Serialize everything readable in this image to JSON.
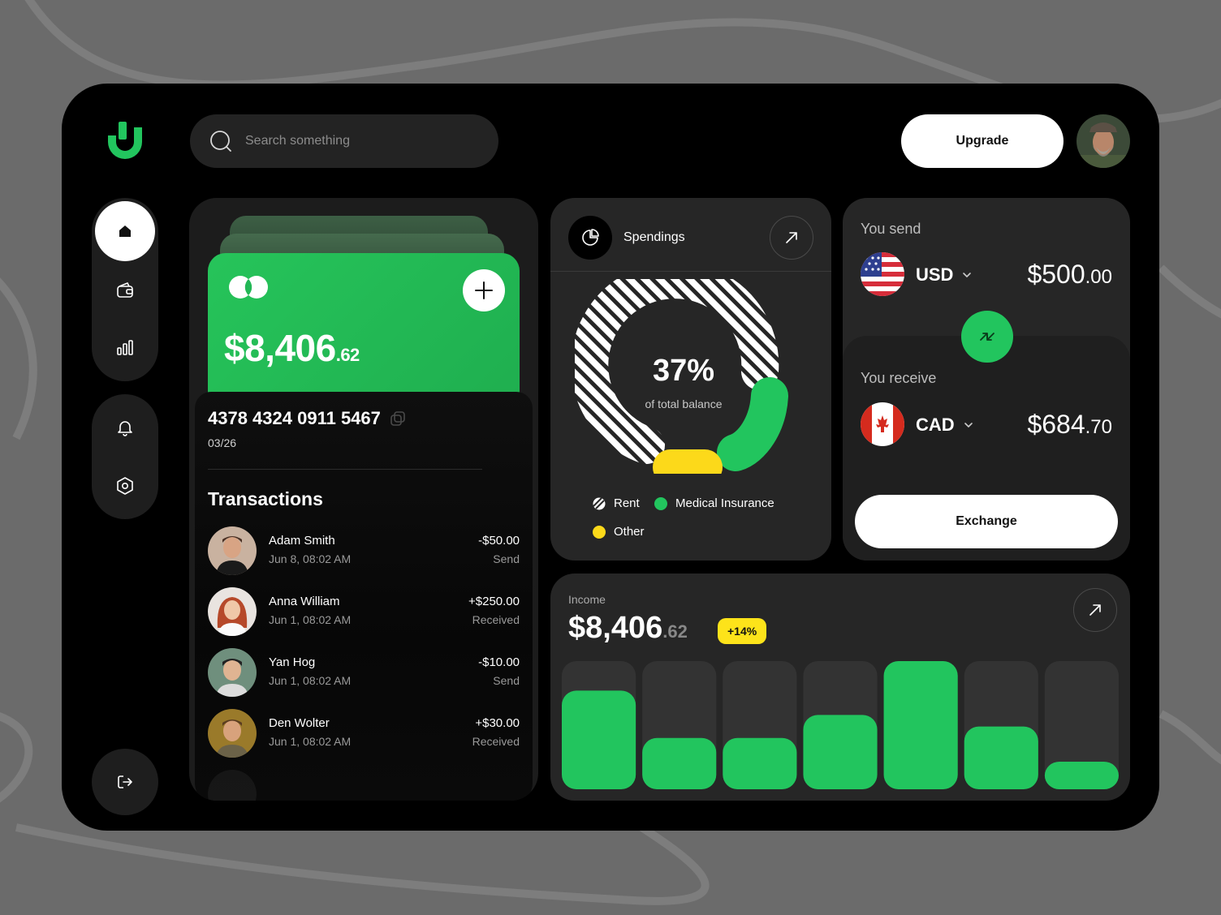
{
  "search": {
    "placeholder": "Search something"
  },
  "header": {
    "upgrade_label": "Upgrade"
  },
  "card": {
    "balance_main": "$8,406",
    "balance_cents": ".62",
    "number": "4378 4324 0911 5467",
    "expiry": "03/26"
  },
  "transactions": {
    "title": "Transactions",
    "items": [
      {
        "name": "Adam Smith",
        "date": "Jun 8, 08:02 AM",
        "amount": "-$50.00",
        "status": "Send"
      },
      {
        "name": "Anna William",
        "date": "Jun 1, 08:02 AM",
        "amount": "+$250.00",
        "status": "Received"
      },
      {
        "name": "Yan Hog",
        "date": "Jun 1, 08:02 AM",
        "amount": "-$10.00",
        "status": "Send"
      },
      {
        "name": "Den Wolter",
        "date": "Jun 1, 08:02 AM",
        "amount": "+$30.00",
        "status": "Received"
      }
    ]
  },
  "spendings": {
    "title": "Spendings",
    "percent": "37%",
    "percent_label": "of total balance",
    "legend": [
      {
        "label": "Rent",
        "color": "#ffffff"
      },
      {
        "label": "Medical Insurance",
        "color": "#22c55e"
      },
      {
        "label": "Other",
        "color": "#fcd91a"
      }
    ]
  },
  "exchange": {
    "send_label": "You send",
    "send_currency": "USD",
    "send_amount_main": "$500",
    "send_amount_cents": ".00",
    "receive_label": "You receive",
    "receive_currency": "CAD",
    "receive_amount_main": "$684",
    "receive_amount_cents": ".70",
    "button_label": "Exchange"
  },
  "income": {
    "label": "Income",
    "amount_main": "$8,406",
    "amount_cents": ".62",
    "change": "+14%"
  },
  "chart_data": {
    "type": "bar",
    "categories": [
      "1",
      "2",
      "3",
      "4",
      "5",
      "6",
      "7"
    ],
    "values": [
      0.77,
      0.4,
      0.4,
      0.58,
      1.0,
      0.49,
      0.21
    ],
    "ylim": [
      0,
      1
    ]
  },
  "colors": {
    "accent": "#22c55e",
    "yellow": "#fcd91a",
    "panel": "#262626",
    "background": "#000000"
  }
}
